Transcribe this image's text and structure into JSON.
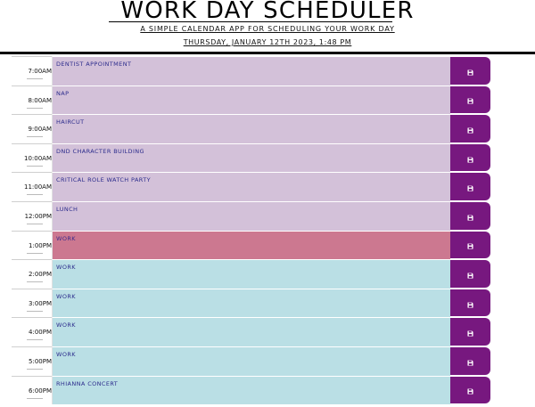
{
  "header": {
    "title": "Work Day Scheduler",
    "subtitle": "A simple calendar app for scheduling your work day",
    "current_date": "Thursday, January 12th 2023, 1:48 pm"
  },
  "schedule": [
    {
      "hour": "7:00am",
      "event": "dentist appointment",
      "state": "past"
    },
    {
      "hour": "8:00am",
      "event": "nap",
      "state": "past"
    },
    {
      "hour": "9:00am",
      "event": "haircut",
      "state": "past"
    },
    {
      "hour": "10:00am",
      "event": "DnD character building",
      "state": "past"
    },
    {
      "hour": "11:00am",
      "event": "critical role watch party",
      "state": "past"
    },
    {
      "hour": "12:00pm",
      "event": "lunch",
      "state": "past"
    },
    {
      "hour": "1:00pm",
      "event": "work",
      "state": "present"
    },
    {
      "hour": "2:00pm",
      "event": "work",
      "state": "future"
    },
    {
      "hour": "3:00pm",
      "event": "work",
      "state": "future"
    },
    {
      "hour": "4:00pm",
      "event": "work",
      "state": "future"
    },
    {
      "hour": "5:00pm",
      "event": "work",
      "state": "future"
    },
    {
      "hour": "6:00pm",
      "event": "rhianna concert",
      "state": "future"
    }
  ],
  "icons": {
    "save": "floppy-disk-icon"
  },
  "colors": {
    "past": "#d3c1d9",
    "present": "#cc7890",
    "future": "#badfe5",
    "save_button": "#77187f"
  }
}
